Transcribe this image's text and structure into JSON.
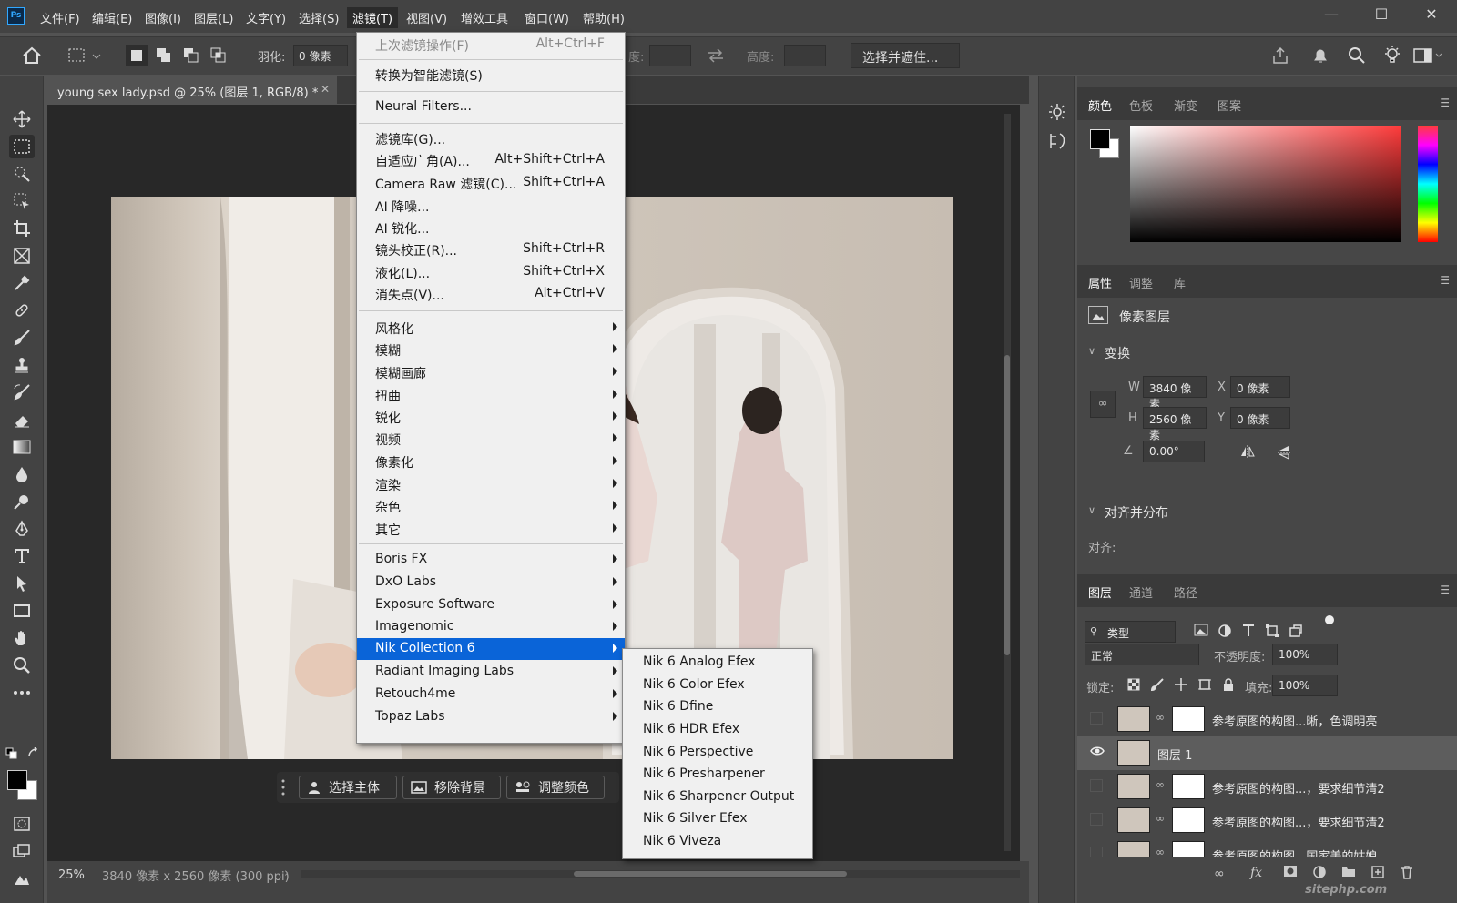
{
  "menubar": {
    "items": [
      "文件(F)",
      "编辑(E)",
      "图像(I)",
      "图层(L)",
      "文字(Y)",
      "选择(S)",
      "滤镜(T)",
      "视图(V)",
      "增效工具",
      "窗口(W)",
      "帮助(H)"
    ],
    "active_index": 6
  },
  "options": {
    "feather_label": "羽化:",
    "feather_value": "0 像素",
    "height_label": "高度:",
    "width_label_partial": "度:",
    "select_mask_label": "选择并遮住..."
  },
  "document": {
    "tab_title": "young sex lady.psd @ 25% (图层 1, RGB/8) *"
  },
  "status": {
    "zoom": "25%",
    "dimensions": "3840 像素 x 2560 像素 (300 ppi)"
  },
  "context_bar": {
    "buttons": [
      "选择主体",
      "移除背景",
      "调整颜色"
    ]
  },
  "filter_menu": {
    "items": [
      {
        "label": "上次滤镜操作(F)",
        "shortcut": "Alt+Ctrl+F",
        "disabled": true
      },
      {
        "label": "转换为智能滤镜(S)",
        "shortcut": ""
      },
      {
        "label": "Neural Filters...",
        "shortcut": ""
      },
      {
        "label": "滤镜库(G)...",
        "shortcut": ""
      },
      {
        "label": "自适应广角(A)...",
        "shortcut": "Alt+Shift+Ctrl+A"
      },
      {
        "label": "Camera Raw 滤镜(C)...",
        "shortcut": "Shift+Ctrl+A"
      },
      {
        "label": "AI 降噪...",
        "shortcut": ""
      },
      {
        "label": "AI 锐化...",
        "shortcut": ""
      },
      {
        "label": "镜头校正(R)...",
        "shortcut": "Shift+Ctrl+R"
      },
      {
        "label": "液化(L)...",
        "shortcut": "Shift+Ctrl+X"
      },
      {
        "label": "消失点(V)...",
        "shortcut": "Alt+Ctrl+V"
      },
      {
        "label": "风格化",
        "submenu": true
      },
      {
        "label": "模糊",
        "submenu": true
      },
      {
        "label": "模糊画廊",
        "submenu": true
      },
      {
        "label": "扭曲",
        "submenu": true
      },
      {
        "label": "锐化",
        "submenu": true
      },
      {
        "label": "视频",
        "submenu": true
      },
      {
        "label": "像素化",
        "submenu": true
      },
      {
        "label": "渲染",
        "submenu": true
      },
      {
        "label": "杂色",
        "submenu": true
      },
      {
        "label": "其它",
        "submenu": true
      },
      {
        "label": "Boris FX",
        "submenu": true
      },
      {
        "label": "DxO Labs",
        "submenu": true
      },
      {
        "label": "Exposure Software",
        "submenu": true
      },
      {
        "label": "Imagenomic",
        "submenu": true
      },
      {
        "label": "Nik Collection 6",
        "submenu": true,
        "highlighted": true
      },
      {
        "label": "Radiant Imaging Labs",
        "submenu": true
      },
      {
        "label": "Retouch4me",
        "submenu": true
      },
      {
        "label": "Topaz Labs",
        "submenu": true
      }
    ]
  },
  "nik_submenu": {
    "items": [
      "Nik 6 Analog Efex",
      "Nik 6 Color Efex",
      "Nik 6 Dfine",
      "Nik 6 HDR Efex",
      "Nik 6 Perspective",
      "Nik 6 Presharpener",
      "Nik 6 Sharpener Output",
      "Nik 6 Silver Efex",
      "Nik 6 Viveza"
    ]
  },
  "color_panel": {
    "tabs": [
      "颜色",
      "色板",
      "渐变",
      "图案"
    ],
    "foreground": "#000000",
    "background": "#ffffff",
    "hue": "#ff3b3b"
  },
  "properties_panel": {
    "tabs": [
      "属性",
      "调整",
      "库"
    ],
    "layer_kind": "像素图层",
    "transform_label": "变换",
    "w_label": "W",
    "w_value": "3840 像素",
    "h_label": "H",
    "h_value": "2560 像素",
    "x_label": "X",
    "x_value": "0 像素",
    "y_label": "Y",
    "y_value": "0 像素",
    "angle_value": "0.00°",
    "align_section": "对齐并分布",
    "align_label": "对齐:"
  },
  "layers_panel": {
    "tabs": [
      "图层",
      "通道",
      "路径"
    ],
    "filter_kind": "类型",
    "blend_mode": "正常",
    "opacity_label": "不透明度:",
    "opacity_value": "100%",
    "lock_label": "锁定:",
    "fill_label": "填充:",
    "fill_value": "100%",
    "layers": [
      {
        "name": "参考原图的构图...晰，色调明亮",
        "visible": false,
        "has_mask": true,
        "selected": false
      },
      {
        "name": "图层 1",
        "visible": true,
        "has_mask": false,
        "selected": true
      },
      {
        "name": "参考原图的构图...，要求细节清2",
        "visible": false,
        "has_mask": true,
        "selected": false
      },
      {
        "name": "参考原图的构图...，要求细节清2",
        "visible": false,
        "has_mask": true,
        "selected": false
      },
      {
        "name": "参考原图的构图...国家美的姑娘",
        "visible": false,
        "has_mask": true,
        "selected": false
      }
    ]
  },
  "watermark": "sitephp.com"
}
